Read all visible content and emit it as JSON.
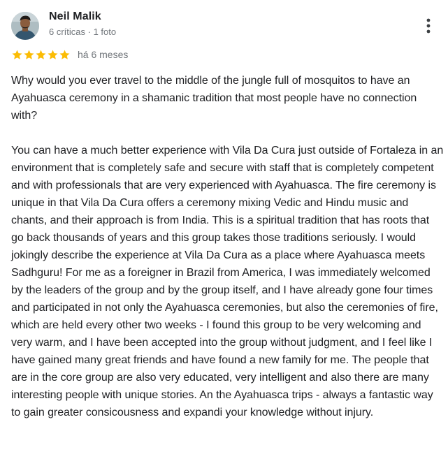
{
  "reviewer": {
    "name": "Neil Malik",
    "meta": "6 críticas · 1 foto",
    "avatar_icon": "person-photo-avatar"
  },
  "menu": {
    "icon": "more-vert-icon"
  },
  "rating": {
    "stars": 5,
    "max_stars": 5,
    "star_color": "#fbbc04",
    "time_ago": "há 6 meses"
  },
  "review": {
    "paragraph1": "Why would you ever travel to the middle of the jungle full of mosquitos to have an Ayahuasca ceremony in a shamanic tradition that most people have no connection with?",
    "paragraph2": "You can have a much better experience with Vila Da Cura just outside of Fortaleza in an environment that is completely safe and secure with staff that is completely competent and with professionals that are very experienced with Ayahuasca. The fire ceremony is unique in that Vila Da Cura offers a ceremony mixing Vedic and Hindu music and chants, and their approach is from India. This is a spiritual tradition that has roots that go back thousands of years and this group takes those traditions seriously. I would jokingly describe the experience at Vila Da Cura as a place where Ayahuasca meets Sadhguru! For me as a foreigner in Brazil from America, I was immediately welcomed by the leaders of the group and by the group itself, and I have already gone four times and participated in not only the Ayahuasca ceremonies, but also the ceremonies of fire, which are held every other two weeks - I found this group to be very welcoming and very warm, and I have been accepted into the group without judgment, and I feel like I have gained many great friends and have found a new family for me. The people that are in the core group are also very educated, very intelligent and also there are many interesting people with unique stories. An the Ayahuasca trips - always a fantastic way to gain greater consicousness and expandi your knowledge without injury."
  }
}
